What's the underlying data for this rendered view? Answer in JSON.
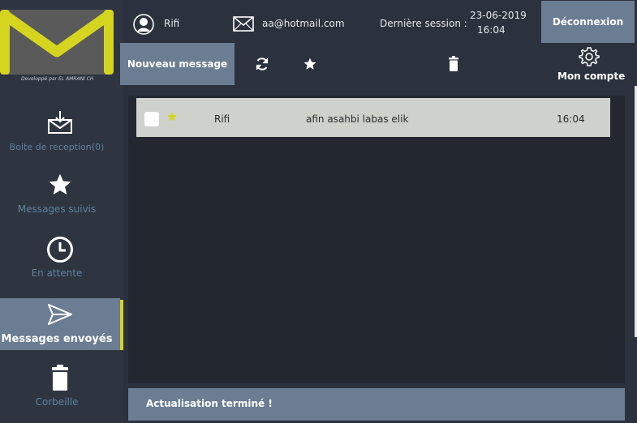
{
  "sidebar": {
    "credit": "Developpé par EL AMRANI CH",
    "items": [
      {
        "label": "Boite de reception(0)",
        "icon": "inbox-icon"
      },
      {
        "label": "Messages suivis",
        "icon": "star-icon"
      },
      {
        "label": "En attente",
        "icon": "clock-icon"
      },
      {
        "label": "Messages envoyés",
        "icon": "send-icon",
        "active": true
      },
      {
        "label": "Corbeille",
        "icon": "trash-icon"
      }
    ]
  },
  "header": {
    "username": "Rifi",
    "email": "aa@hotmail.com",
    "last_session_label": "Dernière session :",
    "last_session_date": "23-06-2019",
    "last_session_time": "16:04",
    "logout_label": "Déconnexion"
  },
  "toolbar": {
    "new_message_label": "Nouveau message",
    "account_label": "Mon compte"
  },
  "messages": [
    {
      "recipient": "Rifi",
      "subject": "afin asahbi labas elik",
      "time": "16:04",
      "starred": true,
      "checked": false
    }
  ],
  "status": {
    "text": "Actualisation terminé !"
  },
  "colors": {
    "background": "#2b313d",
    "accent": "#6b7d93",
    "highlight": "#d5d51f",
    "nav_text": "#5e83a0"
  }
}
